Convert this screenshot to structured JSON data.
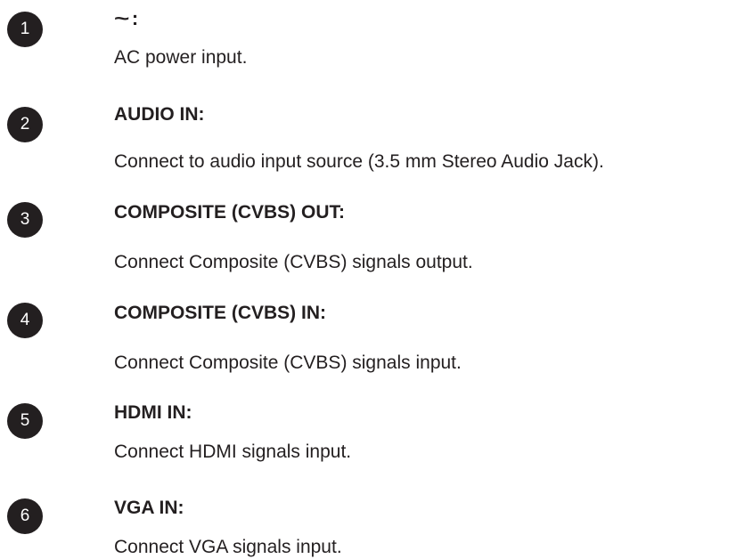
{
  "items": [
    {
      "number": "1",
      "title_symbol": "~",
      "title_suffix": ":",
      "description": "AC power input."
    },
    {
      "number": "2",
      "title": "AUDIO IN:",
      "description": "Connect to audio input source (3.5 mm Stereo Audio Jack)."
    },
    {
      "number": "3",
      "title": "COMPOSITE (CVBS) OUT:",
      "description": "Connect Composite (CVBS) signals output."
    },
    {
      "number": "4",
      "title": "COMPOSITE (CVBS) IN:",
      "description": "Connect Composite (CVBS) signals input."
    },
    {
      "number": "5",
      "title": "HDMI IN:",
      "description": "Connect HDMI signals input."
    },
    {
      "number": "6",
      "title": "VGA IN:",
      "description": "Connect VGA signals input."
    }
  ]
}
